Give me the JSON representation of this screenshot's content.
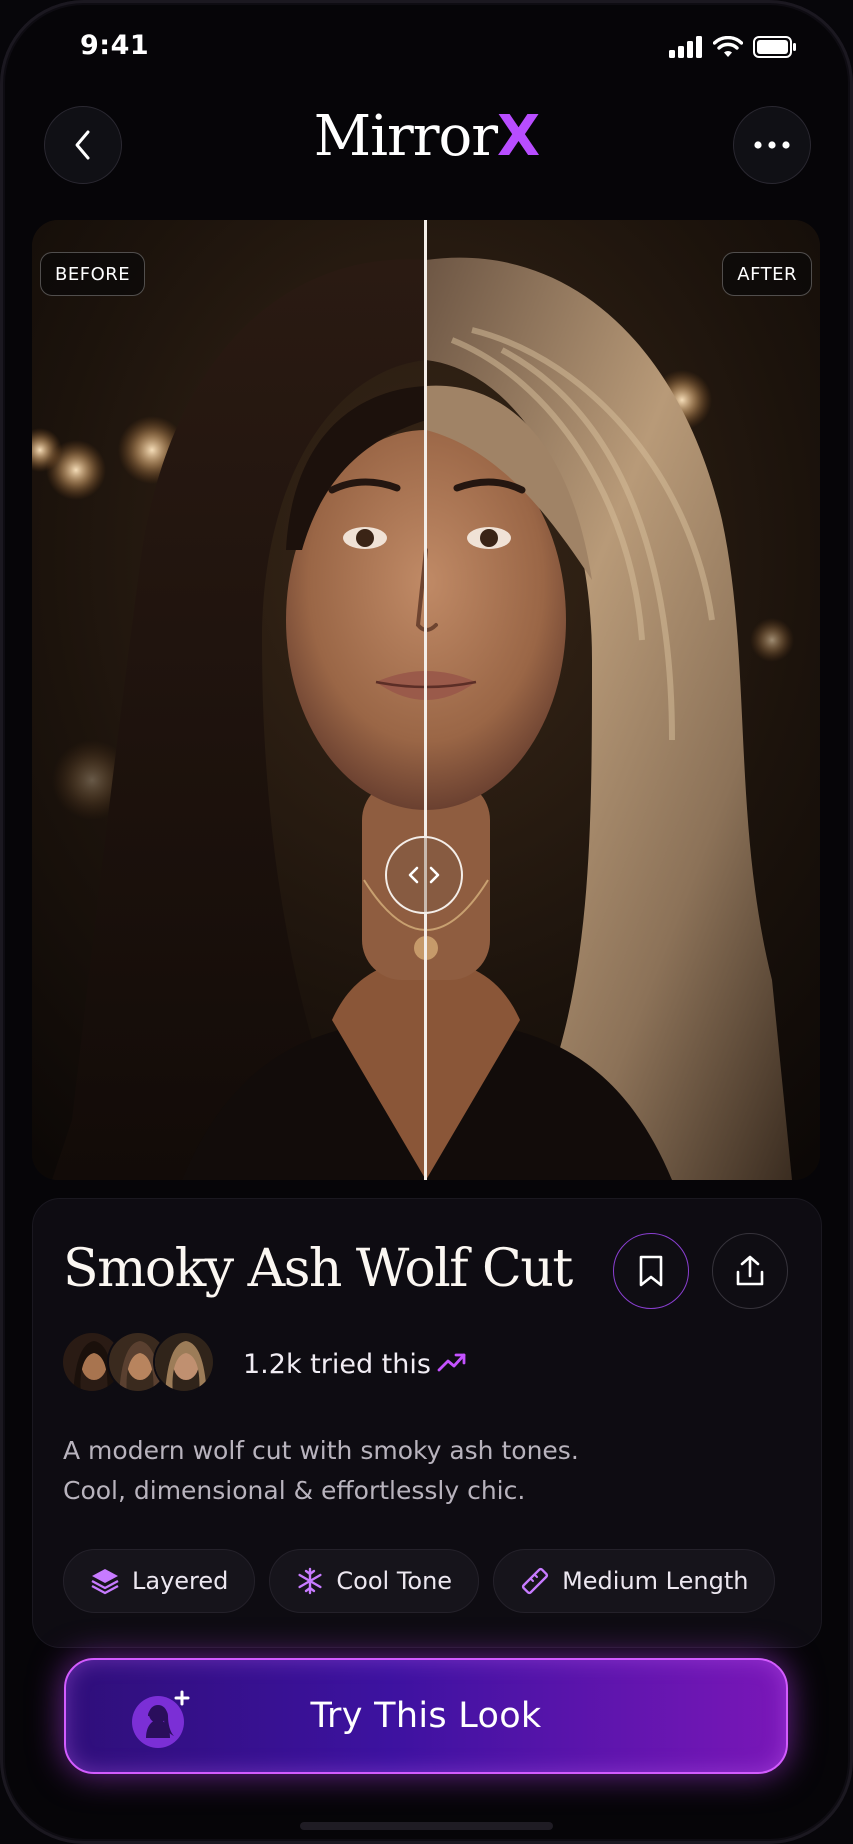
{
  "status_bar": {
    "time": "9:41"
  },
  "header": {
    "brand_main": "Mirror",
    "brand_accent": "X",
    "accent_color": "#b84dff"
  },
  "comparison": {
    "before_label": "BEFORE",
    "after_label": "AFTER"
  },
  "style": {
    "title": "Smoky Ash Wolf Cut",
    "tried_text": "1.2k tried this",
    "description_lines": [
      "A modern wolf cut with smoky ash tones.",
      "Cool, dimensional & effortlessly chic."
    ],
    "chips": [
      {
        "label": "Layered",
        "icon": "layers-icon"
      },
      {
        "label": "Cool Tone",
        "icon": "snowflake-icon"
      },
      {
        "label": "Medium Length",
        "icon": "ruler-icon"
      }
    ]
  },
  "cta": {
    "label": "Try This Look",
    "icon": "avatar-plus-icon"
  }
}
